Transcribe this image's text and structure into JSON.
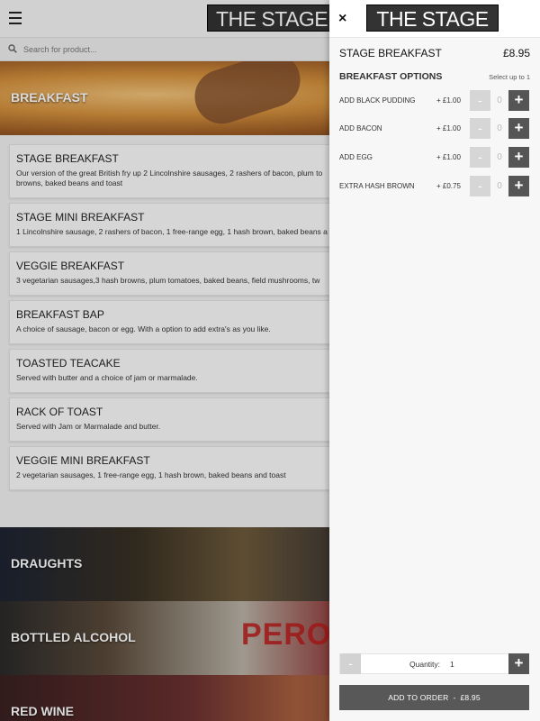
{
  "header": {
    "logo_text": "THE STAGE",
    "menu_icon": "hamburger-menu-icon"
  },
  "search": {
    "placeholder": "Search for product...",
    "icon": "search-icon"
  },
  "categories": {
    "breakfast": "BREAKFAST",
    "draughts": "DRAUGHTS",
    "bottled_alcohol": "BOTTLED ALCOHOL",
    "red_wine": "RED WINE",
    "bottled_banner_text": "PERONI"
  },
  "breakfast_items": [
    {
      "name": "STAGE BREAKFAST",
      "desc": "Our version of the great British fry up 2 Lincolnshire sausages, 2 rashers of bacon, plum to browns, baked beans and toast"
    },
    {
      "name": "STAGE MINI BREAKFAST",
      "desc": "1 Lincolnshire sausage, 2 rashers of bacon, 1 free-range egg, 1 hash brown, baked beans a"
    },
    {
      "name": "VEGGIE BREAKFAST",
      "desc": "3 vegetarian sausages,3 hash browns, plum tomatoes, baked beans, field mushrooms, tw"
    },
    {
      "name": "BREAKFAST BAP",
      "desc": "A choice of sausage, bacon or egg. With a option to add extra's as you like."
    },
    {
      "name": "TOASTED TEACAKE",
      "desc": "Served with butter and a choice of jam or marmalade."
    },
    {
      "name": "RACK OF TOAST",
      "desc": "Served with Jam or Marmalade and butter."
    },
    {
      "name": "VEGGIE MINI BREAKFAST",
      "desc": "2 vegetarian sausages, 1 free-range egg, 1 hash brown, baked beans and toast"
    }
  ],
  "panel": {
    "close_symbol": "×",
    "logo_text": "THE STAGE",
    "product_name": "STAGE BREAKFAST",
    "product_price": "£8.95",
    "options_title": "BREAKFAST OPTIONS",
    "options_hint": "Select up to 1",
    "minus_symbol": "-",
    "plus_symbol": "+",
    "options": [
      {
        "name": "ADD BLACK PUDDING",
        "price": "+ £1.00",
        "qty": "0"
      },
      {
        "name": "ADD BACON",
        "price": "+ £1.00",
        "qty": "0"
      },
      {
        "name": "ADD EGG",
        "price": "+ £1.00",
        "qty": "0"
      },
      {
        "name": "EXTRA HASH BROWN",
        "price": "+ £0.75",
        "qty": "0"
      }
    ],
    "quantity_label": "Quantity:",
    "quantity_value": "1",
    "add_to_order_label": "ADD TO ORDER",
    "add_to_order_separator": "-",
    "add_to_order_price": "£8.95"
  },
  "colors": {
    "button_dark": "#555555",
    "button_disabled": "#d6d6d6",
    "logo_bg": "#333333"
  }
}
